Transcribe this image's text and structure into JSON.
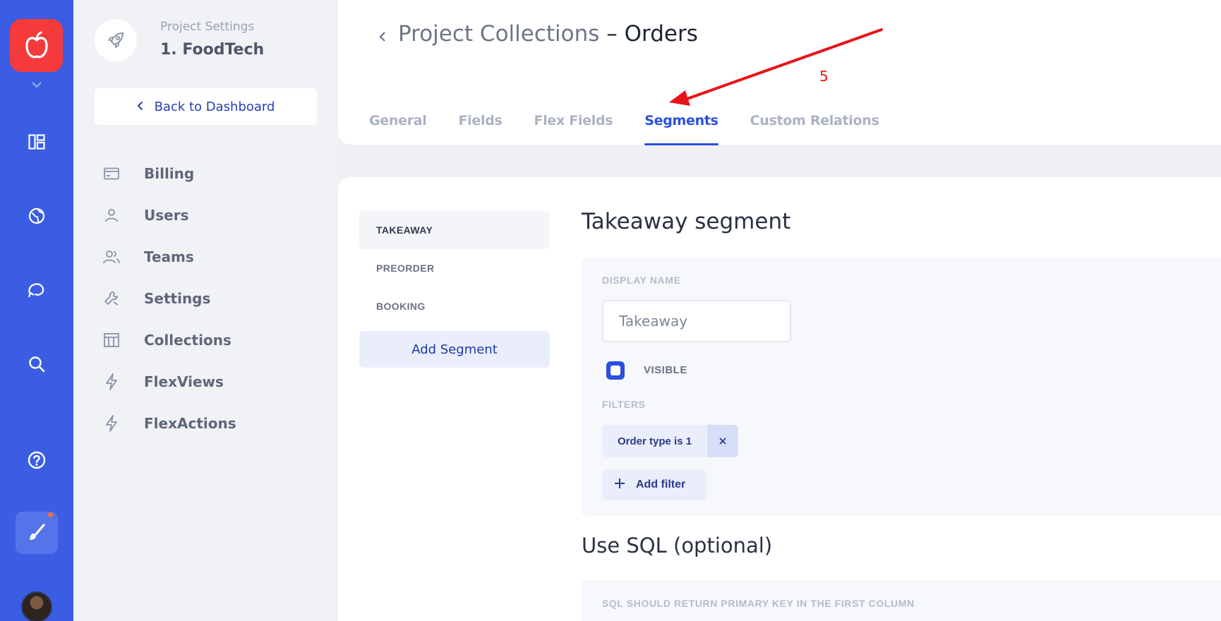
{
  "rail": {
    "icons": [
      "apple-logo-icon",
      "chevron-down-icon",
      "dashboard-icon",
      "globe-icon",
      "chat-refresh-icon",
      "search-icon",
      "help-icon",
      "brush-icon",
      "avatar"
    ]
  },
  "sidebar": {
    "project_subtitle": "Project Settings",
    "project_name": "1. FoodTech",
    "back_label": "Back to Dashboard",
    "items": [
      {
        "label": "Billing",
        "icon": "card-icon"
      },
      {
        "label": "Users",
        "icon": "user-icon"
      },
      {
        "label": "Teams",
        "icon": "team-icon"
      },
      {
        "label": "Settings",
        "icon": "wrench-icon"
      },
      {
        "label": "Collections",
        "icon": "table-icon"
      },
      {
        "label": "FlexViews",
        "icon": "lightning-icon"
      },
      {
        "label": "FlexActions",
        "icon": "lightning-icon"
      }
    ]
  },
  "header": {
    "title_prefix": "Project Collections",
    "title_suffix": " – Orders",
    "tabs": [
      {
        "label": "General",
        "active": false
      },
      {
        "label": "Fields",
        "active": false
      },
      {
        "label": "Flex Fields",
        "active": false
      },
      {
        "label": "Segments",
        "active": true
      },
      {
        "label": "Custom Relations",
        "active": false
      }
    ]
  },
  "segments": {
    "items": [
      "TAKEAWAY",
      "PREORDER",
      "BOOKING"
    ],
    "active_index": 0,
    "add_label": "Add Segment"
  },
  "editor": {
    "title": "Takeaway segment",
    "display_name_label": "DISPLAY NAME",
    "display_name_value": "Takeaway",
    "visible_label": "VISIBLE",
    "visible_checked": true,
    "filters_label": "FILTERS",
    "filter_chip": "Order type is 1",
    "add_filter_label": "Add filter",
    "sql_title": "Use SQL (optional)",
    "sql_hint": "SQL SHOULD RETURN PRIMARY KEY IN THE FIRST COLUMN"
  },
  "annotation": {
    "number": "5",
    "color": "#e8141a"
  },
  "colors": {
    "rail": "#3a5de3",
    "accent": "#2b4fe0",
    "logo": "#f43a3a"
  }
}
